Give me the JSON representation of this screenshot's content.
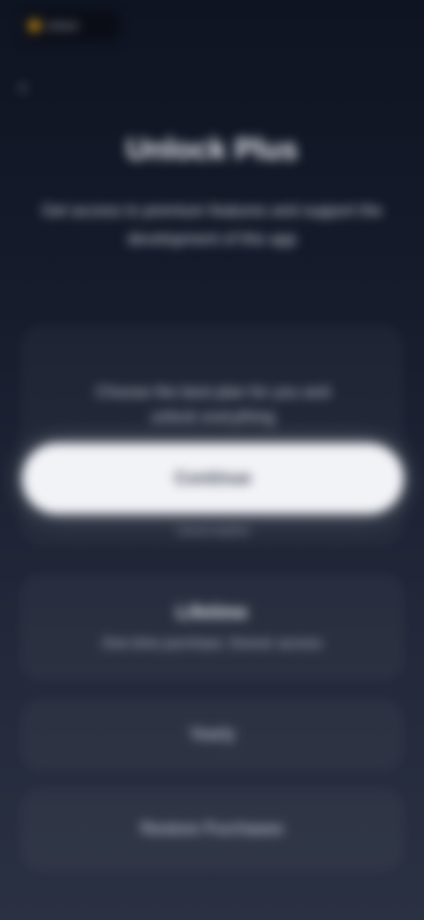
{
  "status_badge": {
    "label": "Unlock"
  },
  "header": {
    "back_icon": "chevron-left-icon",
    "title": "Unlock Plus",
    "subtitle": "Get access to premium features and support the development of this app"
  },
  "offer": {
    "description": "Choose the best plan for you and unlock everything",
    "primary_button": "Continue",
    "note": "Cancel anytime"
  },
  "plans": [
    {
      "title": "Lifetime",
      "subtitle": "One-time purchase, forever access"
    },
    {
      "label": "Yearly"
    },
    {
      "label": "Restore Purchases"
    }
  ]
}
